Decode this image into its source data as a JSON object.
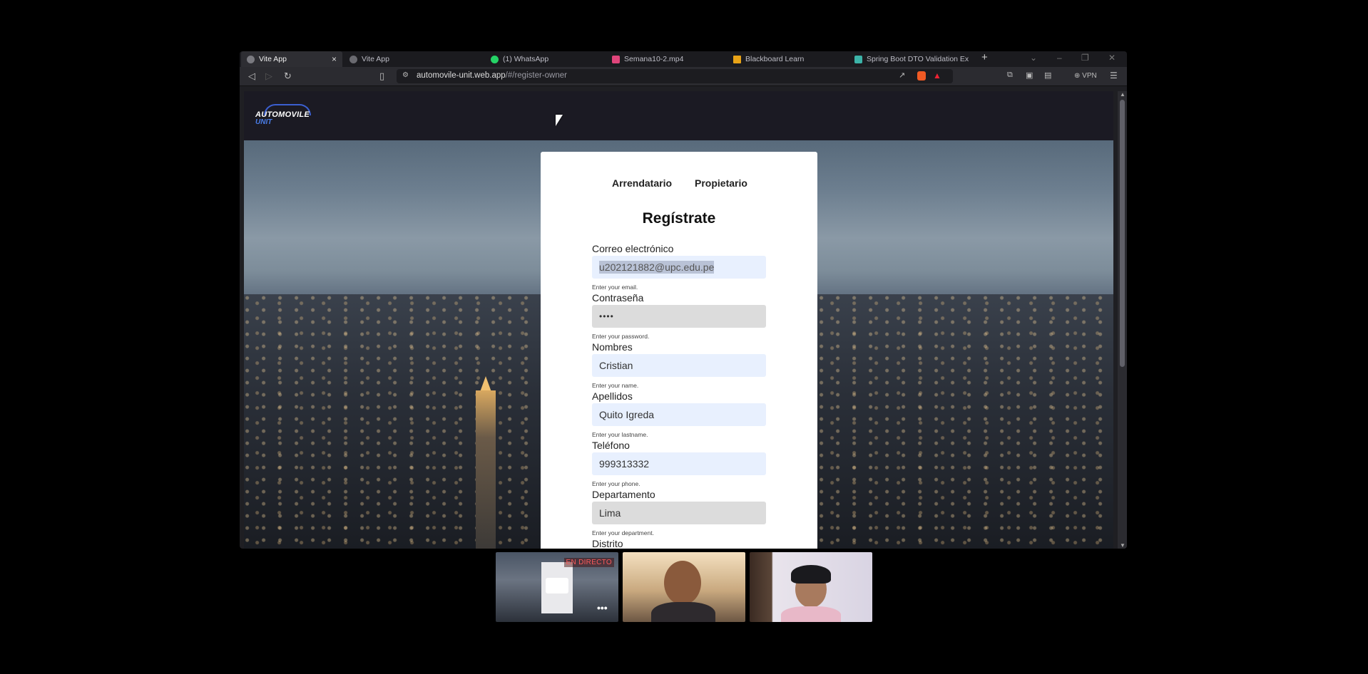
{
  "tabs": [
    {
      "title": "Vite App",
      "active": true,
      "close_icon": "×"
    },
    {
      "title": "Vite App"
    },
    {
      "title": "(1) WhatsApp"
    },
    {
      "title": "Semana10-2.mp4"
    },
    {
      "title": "Blackboard Learn"
    },
    {
      "title": "Spring Boot DTO Validation Exam"
    }
  ],
  "new_tab_label": "+",
  "address": {
    "host": "automovile-unit.web.app",
    "path": "/#/register-owner"
  },
  "vpn_label": "VPN",
  "site": {
    "logo_line1": "AUTOMOVILE",
    "logo_line2": "UNIT"
  },
  "form": {
    "role_tabs": [
      "Arrendatario",
      "Propietario"
    ],
    "title": "Regístrate",
    "fields": [
      {
        "label": "Correo electrónico",
        "value": "u202121882@upc.edu.pe",
        "hint": "Enter your email."
      },
      {
        "label": "Contraseña",
        "value": "••••",
        "hint": "Enter your password."
      },
      {
        "label": "Nombres",
        "value": "Cristian",
        "hint": "Enter your name."
      },
      {
        "label": "Apellidos",
        "value": "Quito Igreda",
        "hint": "Enter your lastname."
      },
      {
        "label": "Teléfono",
        "value": "999313332",
        "hint": "Enter your phone."
      },
      {
        "label": "Departamento",
        "value": "Lima",
        "hint": "Enter your department."
      },
      {
        "label": "Distrito"
      }
    ]
  },
  "video": {
    "live_badge": "EN DIRECTO",
    "more_label": "•••"
  },
  "colors": {
    "nav": "#1b1a23",
    "autofill": "#e8f0fe",
    "logo_blue": "#4a7de8",
    "live_red": "#ff5a5a"
  }
}
